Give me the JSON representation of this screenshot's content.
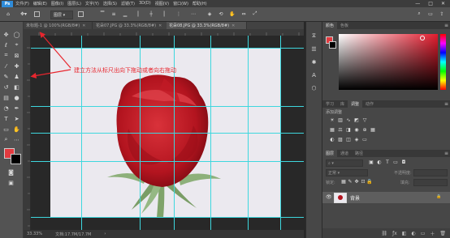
{
  "app": {
    "logo": "Ps"
  },
  "menu": [
    "文件(F)",
    "编辑(E)",
    "图像(I)",
    "图层(L)",
    "文字(Y)",
    "选择(S)",
    "滤镜(T)",
    "3D(D)",
    "视图(V)",
    "窗口(W)",
    "帮助(H)"
  ],
  "window_buttons": {
    "minimize": "—",
    "maximize": "□",
    "close": "✕"
  },
  "options": {
    "mode": "图层"
  },
  "doc_tabs": [
    {
      "title": "未标题-1 @ 100%(RGB/8#)",
      "close": "✕",
      "active": false
    },
    {
      "title": "花朵07.JPG @ 33.3%(RGB/8#)",
      "close": "✕",
      "active": false
    },
    {
      "title": "花朵08.JPG @ 33.3%(RGB/8#)",
      "close": "✕",
      "active": true
    }
  ],
  "annotation": {
    "text": "建立方法从标尺出向下拖动或者向右拖动",
    "color": "#e8262e"
  },
  "status": {
    "zoom": "33.33%",
    "doc_size": "文档:17.7M/17.7M"
  },
  "panels": {
    "color_tabs": [
      "颜色",
      "色板"
    ],
    "adjust_tabs": [
      "学习",
      "库",
      "调整",
      "动作"
    ],
    "adjust_title": "添加调整",
    "layers_tabs": [
      "图层",
      "通道",
      "路径"
    ],
    "blend_mode": "正常",
    "opacity_label": "不透明度:",
    "lock_label": "锁定:",
    "fill_label": "填充:",
    "layer_name": "背景",
    "layer_lock": "🔒"
  },
  "colors": {
    "foreground": "#e33a3f",
    "background": "#000000",
    "guide": "#3ed7de"
  }
}
